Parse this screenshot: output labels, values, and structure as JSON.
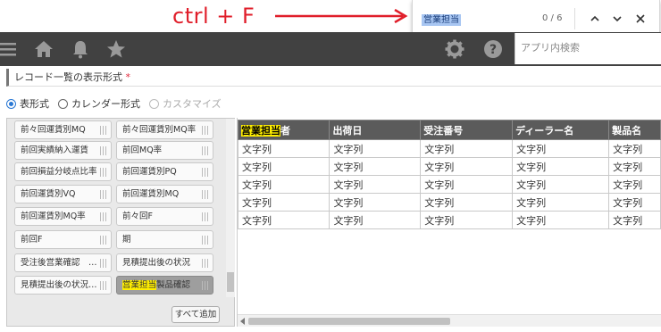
{
  "annotation": {
    "label": "ctrl + F",
    "color": "#e01e2a"
  },
  "findbar": {
    "query": "営業担当",
    "count": "0 / 6"
  },
  "appbar": {
    "icons": [
      "menu-icon",
      "home-icon",
      "bell-icon",
      "star-icon",
      "gear-icon",
      "help-icon"
    ],
    "search_placeholder": "アプリ内検索"
  },
  "section": {
    "title": "レコード一覧の表示形式",
    "required_mark": "*"
  },
  "display_modes": [
    {
      "label": "表形式",
      "selected": true,
      "disabled": false
    },
    {
      "label": "カレンダー形式",
      "selected": false,
      "disabled": false
    },
    {
      "label": "カスタマイズ",
      "selected": false,
      "disabled": true
    }
  ],
  "palette": {
    "fields": [
      [
        "前々回運賃別MQ",
        "前々回運賃別MQ率"
      ],
      [
        "前回実績納入運賃",
        "前回MQ率"
      ],
      [
        "前回損益分岐点比率",
        "前回運賃別PQ"
      ],
      [
        "前回運賃別VQ",
        "前回運賃別MQ"
      ],
      [
        "前回運賃別MQ率",
        "前々回F"
      ],
      [
        "前回F",
        "期"
      ],
      [
        "受注後営業確認　…",
        "見積提出後の状況"
      ],
      [
        "見積提出後の状況…",
        "営業担当製品確認"
      ]
    ],
    "selected_field_highlight": "営業担当",
    "selected_field_rest": "製品確認",
    "add_all_label": "すべて追加"
  },
  "preview_table": {
    "header_highlight": "営業担当",
    "header_rest": "者",
    "columns": [
      "出荷日",
      "受注番号",
      "ディーラー名",
      "製品名"
    ],
    "cell_text": "文字列",
    "rows": 5
  },
  "colors": {
    "appbar": "#414141",
    "table_header": "#5b5b5b",
    "highlight": "#ffee00",
    "radio_accent": "#2a78d4"
  }
}
